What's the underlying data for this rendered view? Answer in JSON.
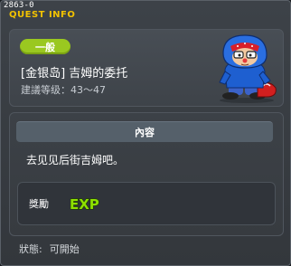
{
  "window": {
    "quest_id": "2863-0",
    "title": "QUEST INFO"
  },
  "quest": {
    "category": "一般",
    "name": "[金银岛] 吉姆的委托",
    "level_range": "建議等级：43～47"
  },
  "content": {
    "header": "內容",
    "description": "去见见后街吉姆吧。"
  },
  "reward": {
    "label": "獎勵",
    "exp_text": "EXP"
  },
  "status": {
    "label": "狀態:",
    "value": "可開始"
  },
  "colors": {
    "title_yellow": "#f2c200",
    "badge_green": "#9ac820",
    "exp_green": "#8ee000",
    "npc_hoodie": "#1e5fd0"
  },
  "icons": {
    "npc": "npc-jim-portrait",
    "reward": "exp-icon"
  }
}
